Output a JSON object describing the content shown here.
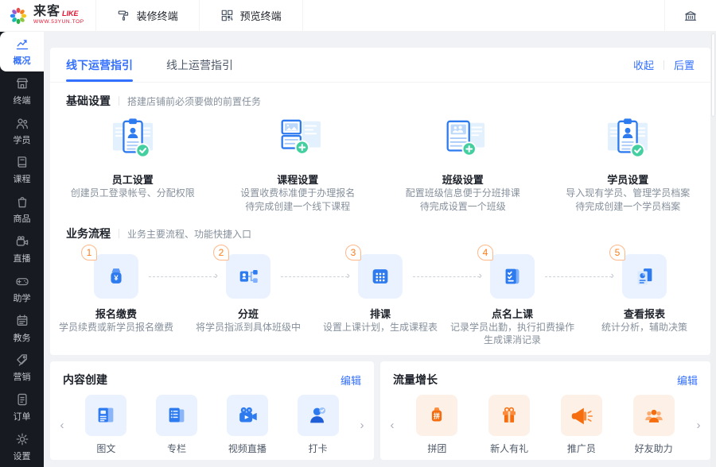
{
  "header": {
    "brand": {
      "name": "来客",
      "suffix": "LIKE",
      "subtitle": "WWW.53YUN.TOP"
    },
    "actions": [
      {
        "label": "装修终端"
      },
      {
        "label": "预览终端"
      }
    ]
  },
  "sidebar": {
    "items": [
      {
        "label": "概况",
        "active": true
      },
      {
        "label": "终端"
      },
      {
        "label": "学员"
      },
      {
        "label": "课程"
      },
      {
        "label": "商品"
      },
      {
        "label": "直播"
      },
      {
        "label": "助学"
      },
      {
        "label": "教务"
      },
      {
        "label": "营销"
      },
      {
        "label": "订单"
      },
      {
        "label": "设置"
      }
    ]
  },
  "guide": {
    "tabs": [
      {
        "label": "线下运营指引",
        "active": true
      },
      {
        "label": "线上运营指引"
      }
    ],
    "collapse": "收起",
    "send_back": "后置",
    "basic": {
      "title": "基础设置",
      "subtitle": "搭建店铺前必须要做的前置任务",
      "cards": [
        {
          "title": "员工设置",
          "lines": [
            "创建员工登录帐号、分配权限"
          ]
        },
        {
          "title": "课程设置",
          "lines": [
            "设置收费标准便于办理报名",
            "待完成创建一个线下课程"
          ]
        },
        {
          "title": "班级设置",
          "lines": [
            "配置班级信息便于分班排课",
            "待完成设置一个班级"
          ]
        },
        {
          "title": "学员设置",
          "lines": [
            "导入现有学员、管理学员档案",
            "待完成创建一个学员档案"
          ]
        }
      ]
    },
    "flow": {
      "title": "业务流程",
      "subtitle": "业务主要流程、功能快捷入口",
      "steps": [
        {
          "num": "1",
          "title": "报名缴费",
          "lines": [
            "学员续费或新学员报名缴费"
          ]
        },
        {
          "num": "2",
          "title": "分班",
          "lines": [
            "将学员指派到具体班级中"
          ]
        },
        {
          "num": "3",
          "title": "排课",
          "lines": [
            "设置上课计划，生成课程表"
          ]
        },
        {
          "num": "4",
          "title": "点名上课",
          "lines": [
            "记录学员出勤，执行扣费操作",
            "生成课消记录"
          ]
        },
        {
          "num": "5",
          "title": "查看报表",
          "lines": [
            "统计分析，辅助决策"
          ]
        }
      ]
    }
  },
  "content_panel": {
    "title": "内容创建",
    "edit": "编辑",
    "items": [
      {
        "label": "图文"
      },
      {
        "label": "专栏"
      },
      {
        "label": "视频直播"
      },
      {
        "label": "打卡"
      }
    ]
  },
  "growth_panel": {
    "title": "流量增长",
    "edit": "编辑",
    "items": [
      {
        "label": "拼团"
      },
      {
        "label": "新人有礼"
      },
      {
        "label": "推广员"
      },
      {
        "label": "好友助力"
      }
    ]
  },
  "glyphs": {
    "yen": "¥",
    "pin": "拼",
    "prev": "‹",
    "next": "›"
  },
  "colors": {
    "accent": "#3370FF",
    "orange": "#FF7D1A",
    "green": "#44CFA1",
    "sidebar_bg": "#171A20",
    "page_bg": "#F0F2F5"
  }
}
